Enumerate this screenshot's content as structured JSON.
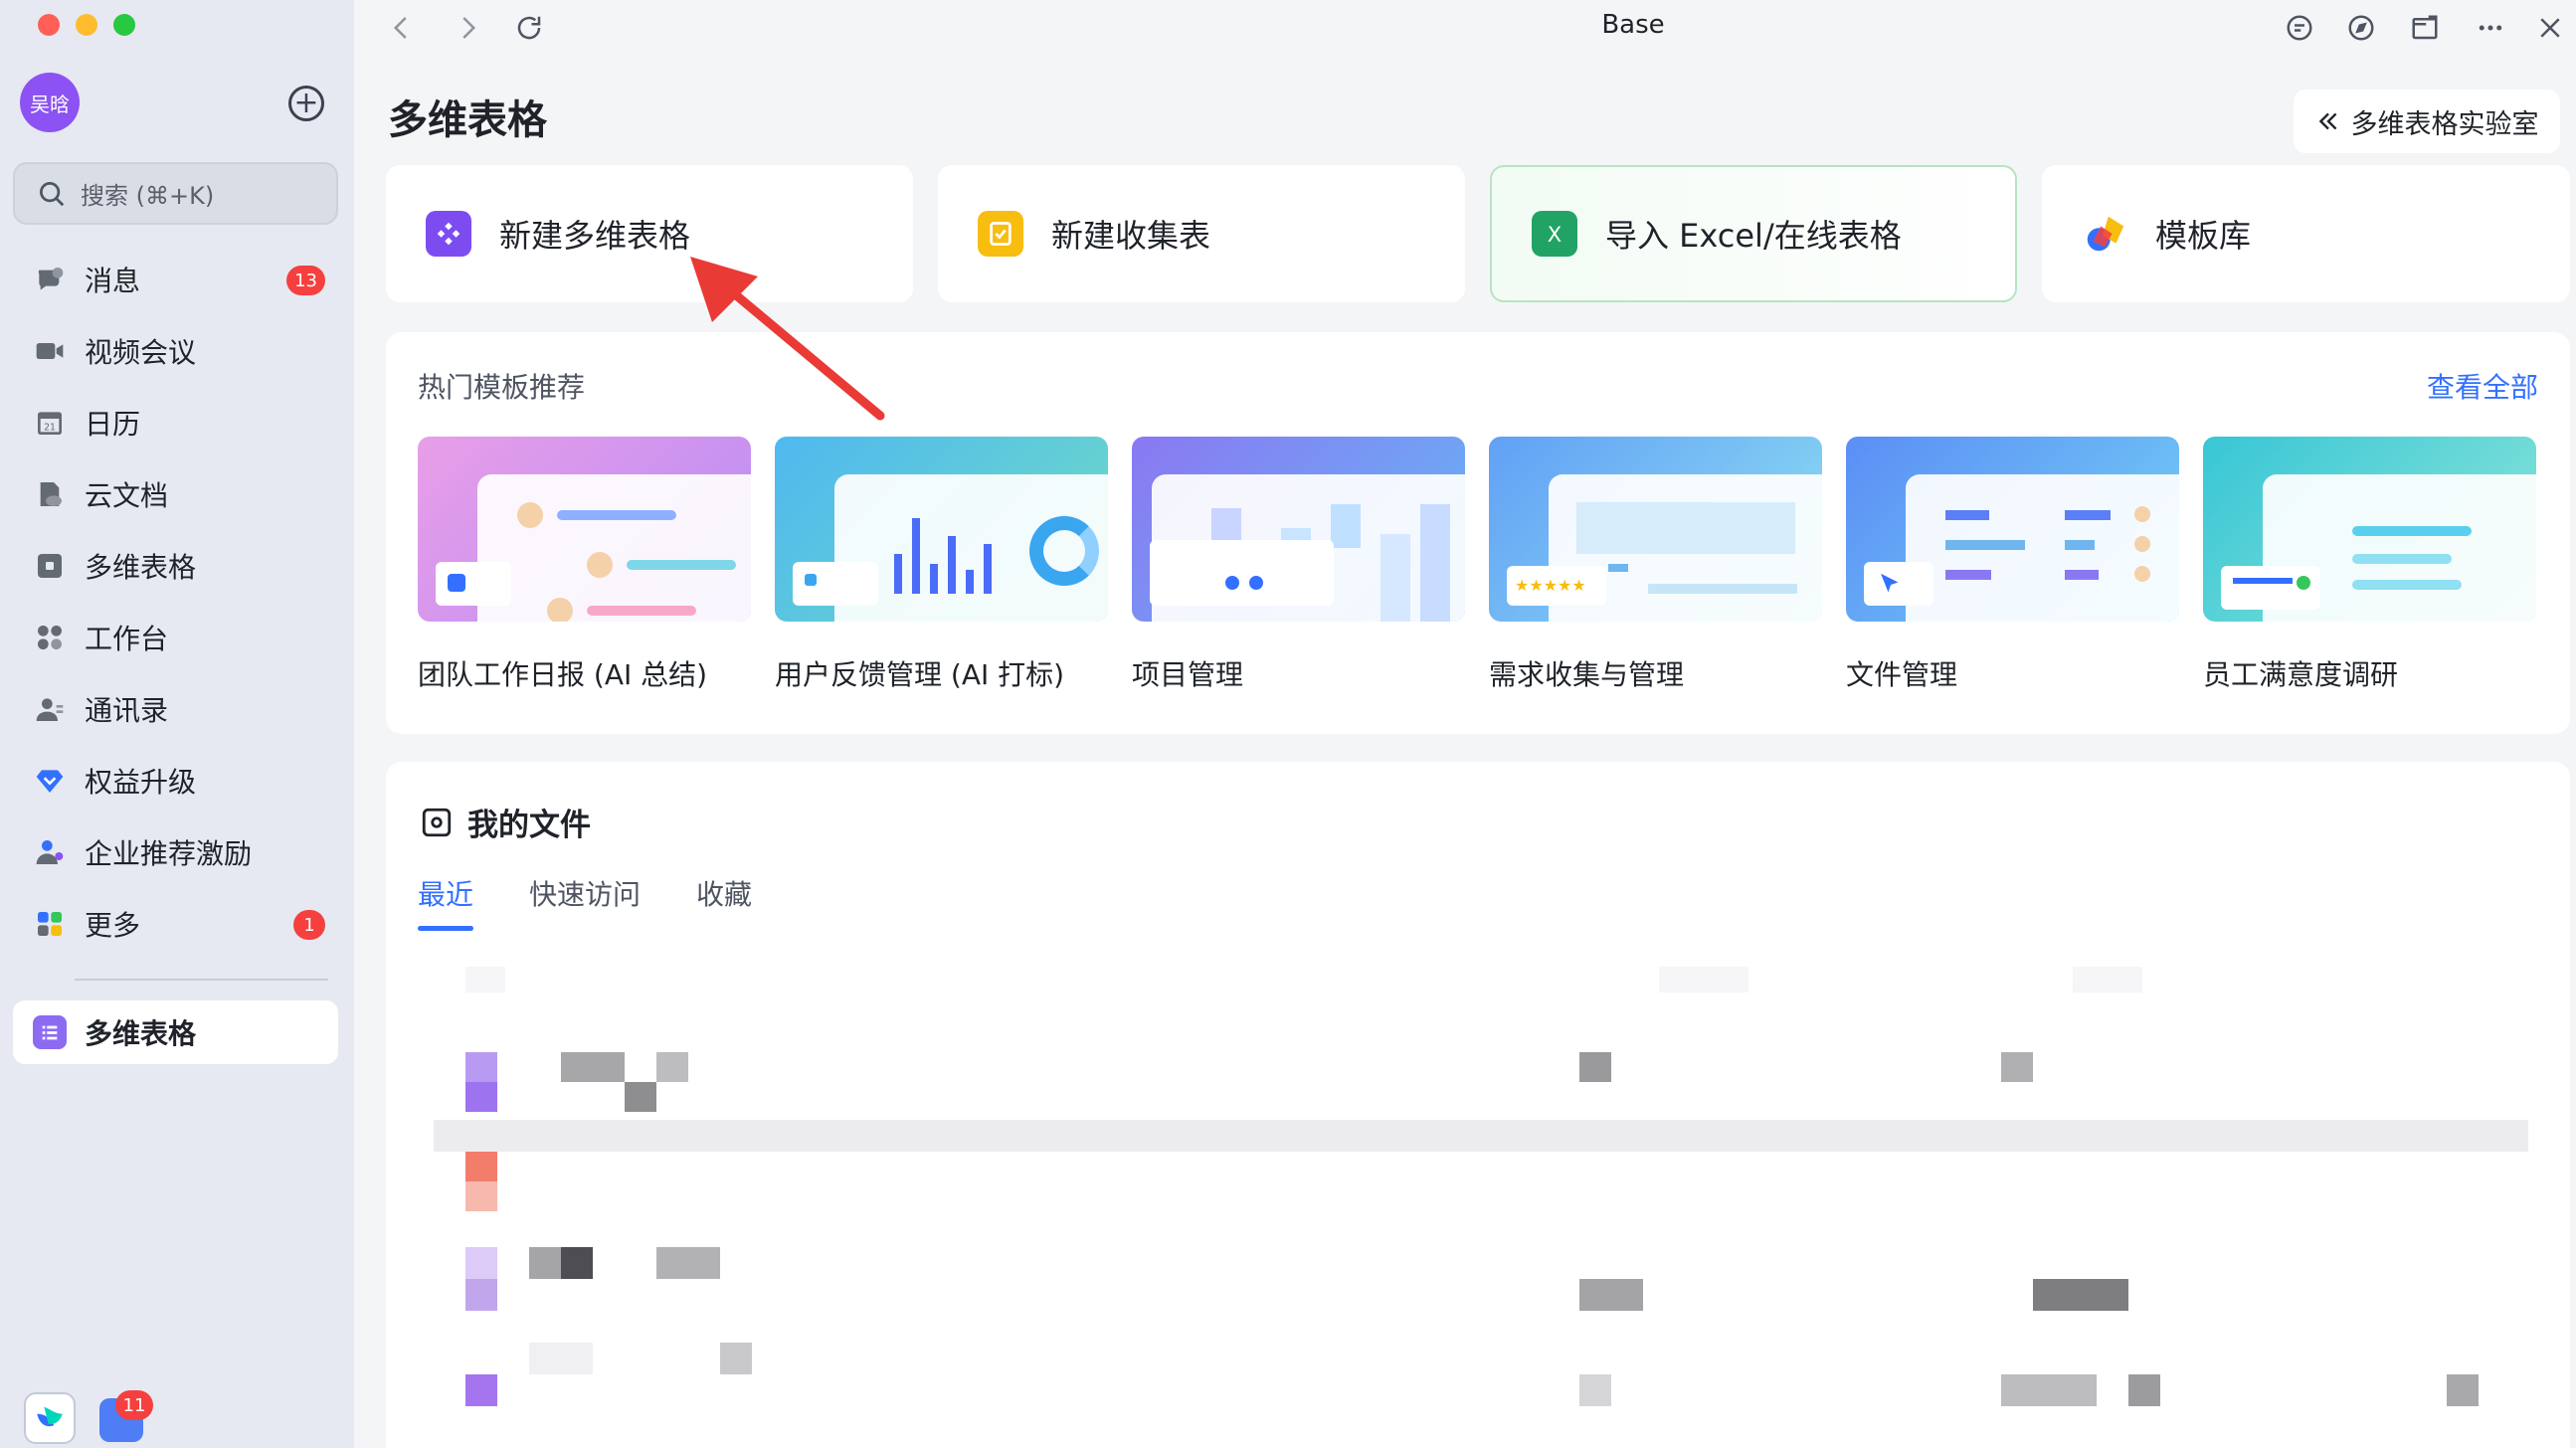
{
  "window": {
    "title": "Base"
  },
  "user": {
    "avatar_text": "吴晗"
  },
  "search": {
    "placeholder": "搜索 (⌘+K)"
  },
  "sidebar": {
    "items": [
      {
        "label": "消息",
        "icon": "chat-bubble-icon",
        "badge": "13"
      },
      {
        "label": "视频会议",
        "icon": "video-camera-icon",
        "badge": ""
      },
      {
        "label": "日历",
        "icon": "calendar-icon",
        "badge": ""
      },
      {
        "label": "云文档",
        "icon": "cloud-doc-icon",
        "badge": ""
      },
      {
        "label": "多维表格",
        "icon": "base-icon",
        "badge": ""
      },
      {
        "label": "工作台",
        "icon": "workplace-icon",
        "badge": ""
      },
      {
        "label": "通讯录",
        "icon": "contacts-icon",
        "badge": ""
      },
      {
        "label": "权益升级",
        "icon": "diamond-icon",
        "badge": ""
      },
      {
        "label": "企业推荐激励",
        "icon": "referral-icon",
        "badge": ""
      },
      {
        "label": "更多",
        "icon": "more-apps-icon",
        "badge": "1"
      }
    ],
    "pinned": {
      "label": "多维表格"
    },
    "dock_badge": "11"
  },
  "main": {
    "title": "多维表格",
    "lab_button": "多维表格实验室",
    "actions": [
      {
        "label": "新建多维表格"
      },
      {
        "label": "新建收集表"
      },
      {
        "label": "导入 Excel/在线表格"
      },
      {
        "label": "模板库"
      }
    ],
    "templates": {
      "heading": "热门模板推荐",
      "view_all": "查看全部",
      "items": [
        {
          "label": "团队工作日报 (AI 总结)"
        },
        {
          "label": "用户反馈管理 (AI 打标)"
        },
        {
          "label": "项目管理"
        },
        {
          "label": "需求收集与管理"
        },
        {
          "label": "文件管理"
        },
        {
          "label": "员工满意度调研"
        }
      ]
    },
    "files": {
      "title": "我的文件",
      "tabs": [
        {
          "label": "最近",
          "active": true
        },
        {
          "label": "快速访问",
          "active": false
        },
        {
          "label": "收藏",
          "active": false
        }
      ]
    }
  },
  "colors": {
    "accent": "#3370ff",
    "badge": "#f5403f",
    "brand_purple": "#8c52f3",
    "excel_green": "#21a366",
    "form_yellow": "#f7bd0f"
  }
}
